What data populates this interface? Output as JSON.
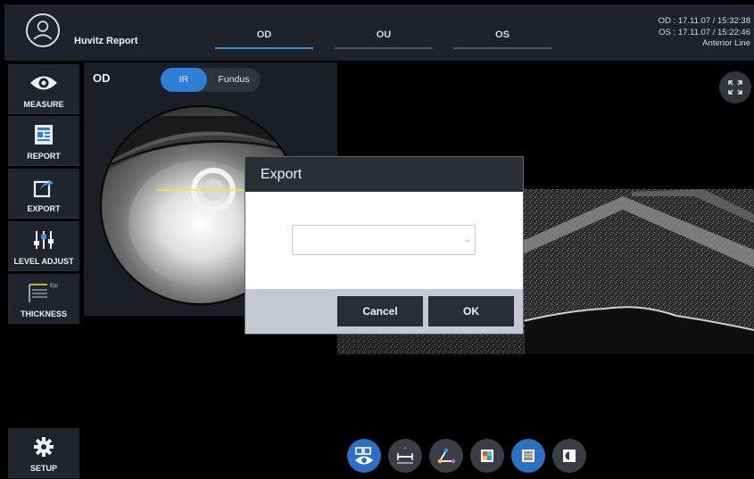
{
  "header": {
    "app_title": "Huvitz Report",
    "eye_tabs": [
      {
        "label": "OD",
        "active": true
      },
      {
        "label": "OU",
        "active": false
      },
      {
        "label": "OS",
        "active": false
      }
    ],
    "scan_info": {
      "od_line": "OD : 17.11.07 / 15:32:38",
      "os_line": "OS : 17.11.07 / 15:22:46",
      "scan_type": "Anterior Line"
    }
  },
  "sidebar": {
    "items": [
      {
        "label": "MEASURE",
        "icon": "eye-icon"
      },
      {
        "label": "REPORT",
        "icon": "report-icon"
      },
      {
        "label": "EXPORT",
        "icon": "export-icon"
      },
      {
        "label": "LEVEL ADJUST",
        "icon": "sliders-icon"
      },
      {
        "label": "THICKNESS",
        "icon": "thickness-icon",
        "sub_label": "Epi"
      }
    ],
    "setup_label": "SETUP"
  },
  "fundus_panel": {
    "eye_label": "OD",
    "mode_options": [
      "IR",
      "Fundus"
    ],
    "selected_mode": "IR"
  },
  "export_dialog": {
    "title": "Export",
    "select_value": "",
    "cancel_label": "Cancel",
    "ok_label": "OK"
  },
  "toolbar": {
    "tools": [
      {
        "name": "view-mode-icon",
        "active": true
      },
      {
        "name": "caliper-icon",
        "active": false
      },
      {
        "name": "angle-icon",
        "active": false
      },
      {
        "name": "color-map-icon",
        "active": false
      },
      {
        "name": "thickness-map-icon",
        "active": true
      },
      {
        "name": "contrast-icon",
        "active": false
      }
    ]
  },
  "colors": {
    "accent": "#3d8ee8",
    "toggle_active": "#2f7fd9",
    "tool_active": "#2f6fc2",
    "scan_line": "#e6f030"
  }
}
